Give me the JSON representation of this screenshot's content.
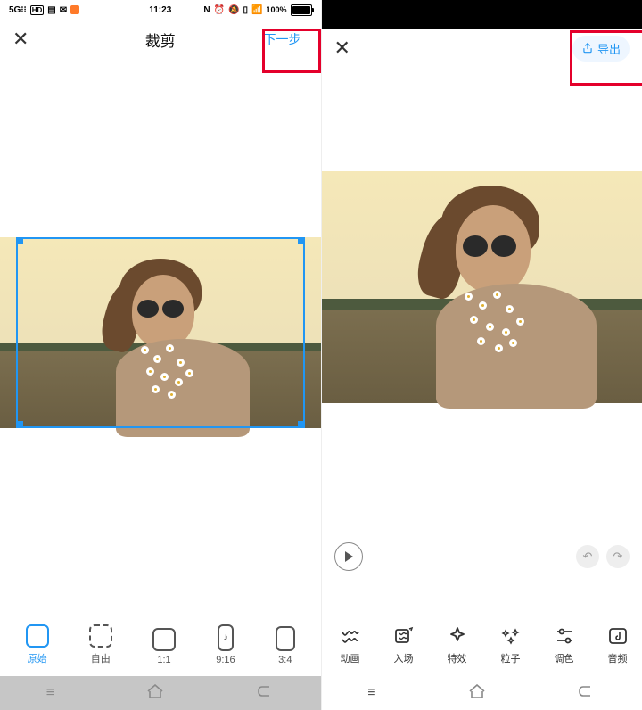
{
  "left": {
    "status": {
      "time": "11:23",
      "battery_pct": "100%"
    },
    "title": "裁剪",
    "next_label": "下一步",
    "crop_options": [
      {
        "label": "原始",
        "active": true,
        "shape": "orig"
      },
      {
        "label": "自由",
        "active": false,
        "shape": "dashed"
      },
      {
        "label": "1:1",
        "active": false,
        "shape": "sq"
      },
      {
        "label": "9:16",
        "active": false,
        "shape": "s916"
      },
      {
        "label": "3:4",
        "active": false,
        "shape": "s34"
      }
    ]
  },
  "right": {
    "export_label": "导出",
    "fx": [
      {
        "label": "动画"
      },
      {
        "label": "入场"
      },
      {
        "label": "特效"
      },
      {
        "label": "粒子"
      },
      {
        "label": "调色"
      },
      {
        "label": "音频"
      }
    ]
  }
}
